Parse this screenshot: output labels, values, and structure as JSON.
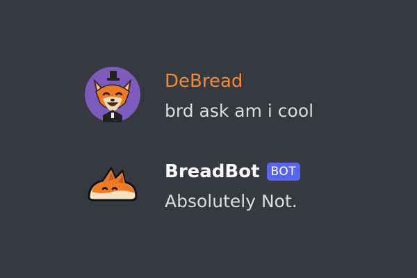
{
  "colors": {
    "background": "#36393f",
    "username_debread": "#f28a3a",
    "username_breadbot": "#ffffff",
    "bot_tag": "#5865f2",
    "message_text": "#dcddde",
    "avatar_bg": "#7d5bbd"
  },
  "messages": [
    {
      "avatar_icon": "fox-avatar-icon",
      "username": "DeBread",
      "content": "brd ask am i cool"
    },
    {
      "avatar_icon": "bread-fox-bot-icon",
      "username": "BreadBot",
      "bot_tag": "BOT",
      "content": "Absolutely Not."
    }
  ]
}
